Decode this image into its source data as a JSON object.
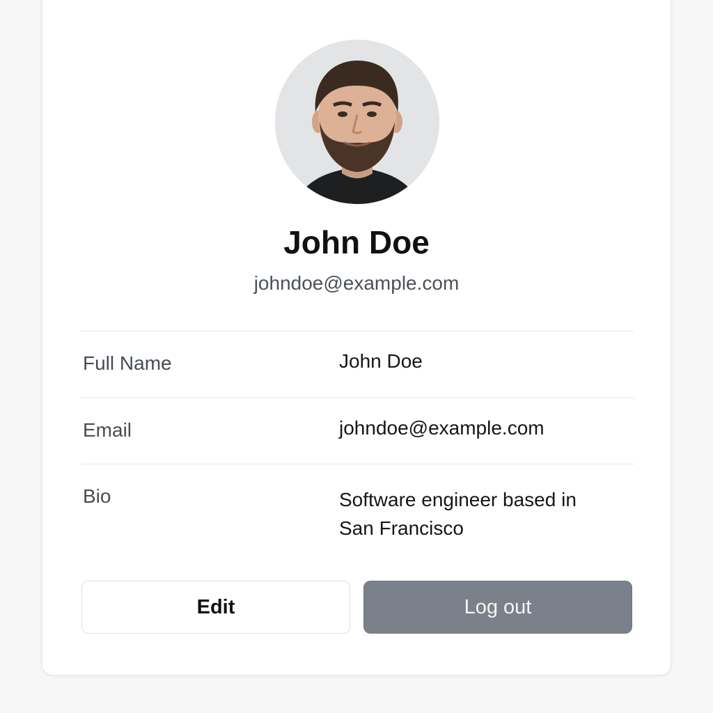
{
  "profile": {
    "name": "John Doe",
    "email": "johndoe@example.com",
    "avatar_alt": "profile-photo"
  },
  "details": [
    {
      "label": "Full Name",
      "value": "John Doe"
    },
    {
      "label": "Email",
      "value": "johndoe@example.com"
    },
    {
      "label": "Bio",
      "value_line1": "Software engineer based in",
      "value_line2": "San Francisco"
    }
  ],
  "actions": {
    "edit_label": "Edit",
    "logout_label": "Log out"
  },
  "colors": {
    "page_bg": "#f7f7f7",
    "card_bg": "#ffffff",
    "logout_bg": "#7b818a",
    "divider": "#e6e8eb"
  }
}
